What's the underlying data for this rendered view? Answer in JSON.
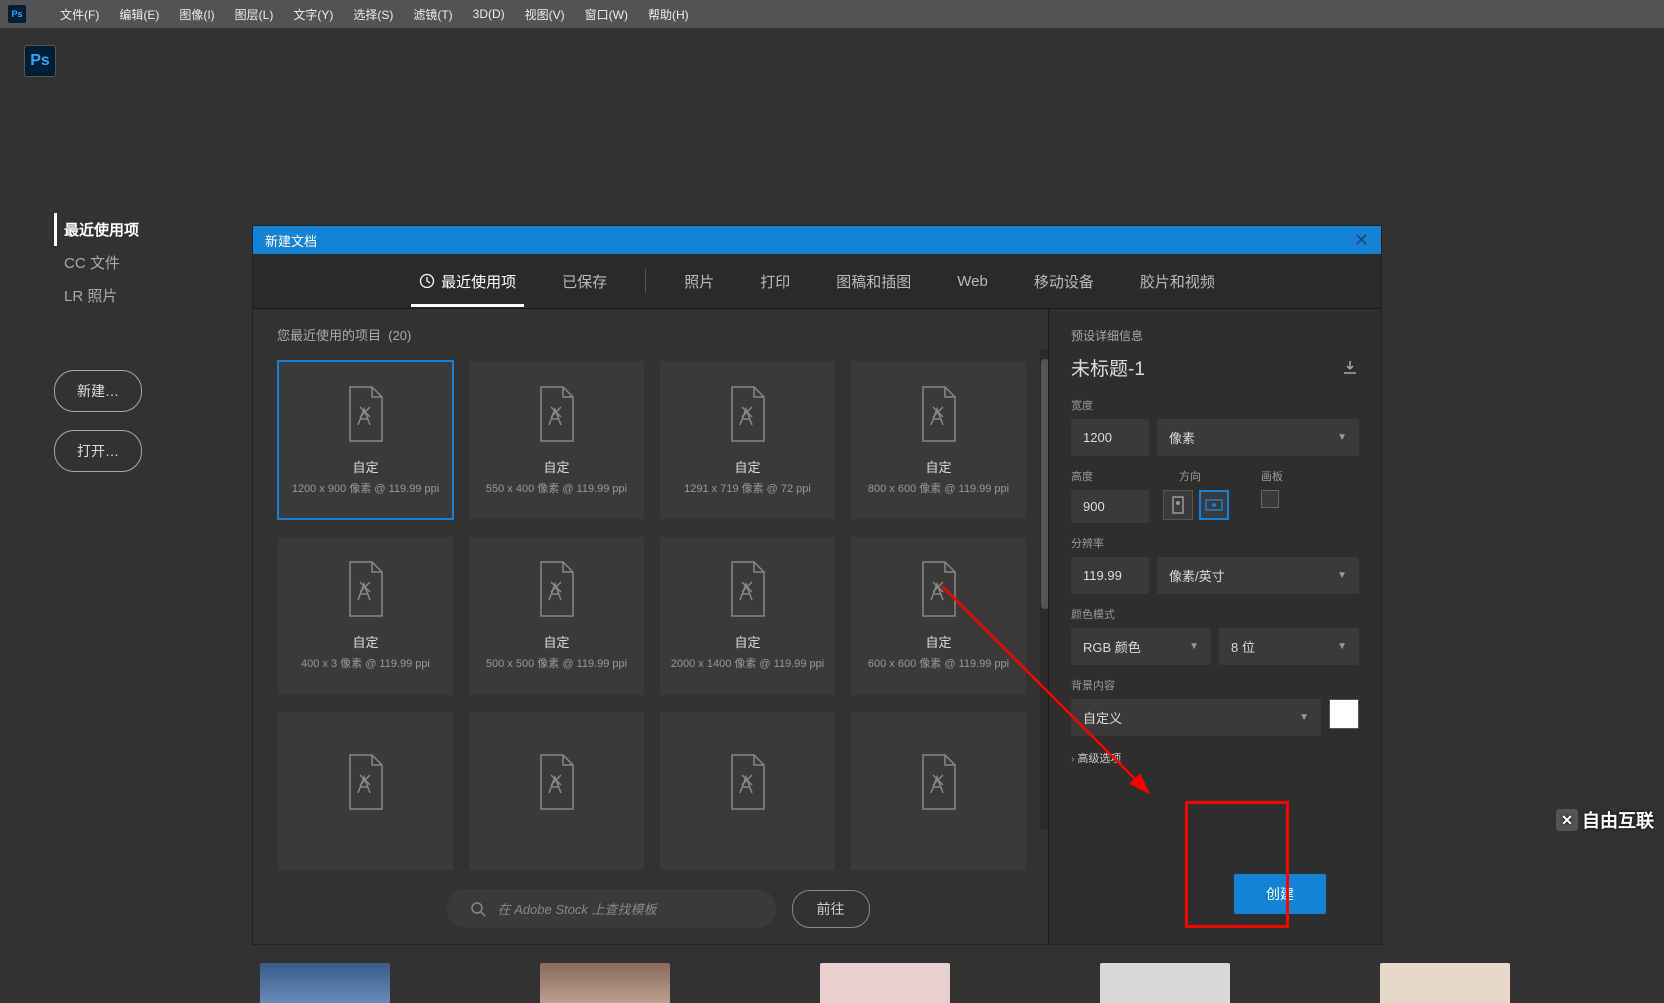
{
  "menubar": {
    "logo": "Ps",
    "items": [
      "文件(F)",
      "编辑(E)",
      "图像(I)",
      "图层(L)",
      "文字(Y)",
      "选择(S)",
      "滤镜(T)",
      "3D(D)",
      "视图(V)",
      "窗口(W)",
      "帮助(H)"
    ]
  },
  "toolbar": {
    "logo": "Ps"
  },
  "sidebar": {
    "items": [
      {
        "label": "最近使用项",
        "active": true
      },
      {
        "label": "CC 文件",
        "active": false
      },
      {
        "label": "LR 照片",
        "active": false
      }
    ],
    "new_button": "新建…",
    "open_button": "打开…"
  },
  "dialog": {
    "title": "新建文档",
    "close": "✕",
    "tabs": [
      {
        "label": "最近使用项",
        "active": true,
        "icon": "clock"
      },
      {
        "label": "已保存"
      },
      {
        "label": "照片",
        "divider_before": true
      },
      {
        "label": "打印"
      },
      {
        "label": "图稿和插图"
      },
      {
        "label": "Web"
      },
      {
        "label": "移动设备"
      },
      {
        "label": "胶片和视频"
      }
    ],
    "presets": {
      "heading_prefix": "您最近使用的项目",
      "count": "(20)",
      "cards": [
        {
          "title": "自定",
          "sub": "1200 x 900 像素 @ 119.99 ppi",
          "selected": true
        },
        {
          "title": "自定",
          "sub": "550 x 400 像素 @ 119.99 ppi"
        },
        {
          "title": "自定",
          "sub": "1291 x 719 像素 @ 72 ppi"
        },
        {
          "title": "自定",
          "sub": "800 x 600 像素 @ 119.99 ppi"
        },
        {
          "title": "自定",
          "sub": "400 x 3 像素 @ 119.99 ppi"
        },
        {
          "title": "自定",
          "sub": "500 x 500 像素 @ 119.99 ppi"
        },
        {
          "title": "自定",
          "sub": "2000 x 1400 像素 @ 119.99 ppi"
        },
        {
          "title": "自定",
          "sub": "600 x 600 像素 @ 119.99 ppi"
        },
        {
          "title": "",
          "sub": ""
        },
        {
          "title": "",
          "sub": ""
        },
        {
          "title": "",
          "sub": ""
        },
        {
          "title": "",
          "sub": ""
        }
      ]
    },
    "search": {
      "placeholder": "在 Adobe Stock 上查找模板",
      "go_label": "前往"
    },
    "details": {
      "heading": "预设详细信息",
      "doc_name": "未标题-1",
      "width_label": "宽度",
      "width_value": "1200",
      "width_unit": "像素",
      "height_label": "高度",
      "height_value": "900",
      "orientation_label": "方向",
      "artboard_label": "画板",
      "resolution_label": "分辨率",
      "resolution_value": "119.99",
      "resolution_unit": "像素/英寸",
      "color_mode_label": "颜色模式",
      "color_mode_value": "RGB 颜色",
      "bit_depth": "8 位",
      "background_label": "背景内容",
      "background_value": "自定义",
      "advanced_label": "高级选项",
      "create_button": "创建"
    }
  },
  "watermark": "自由互联"
}
